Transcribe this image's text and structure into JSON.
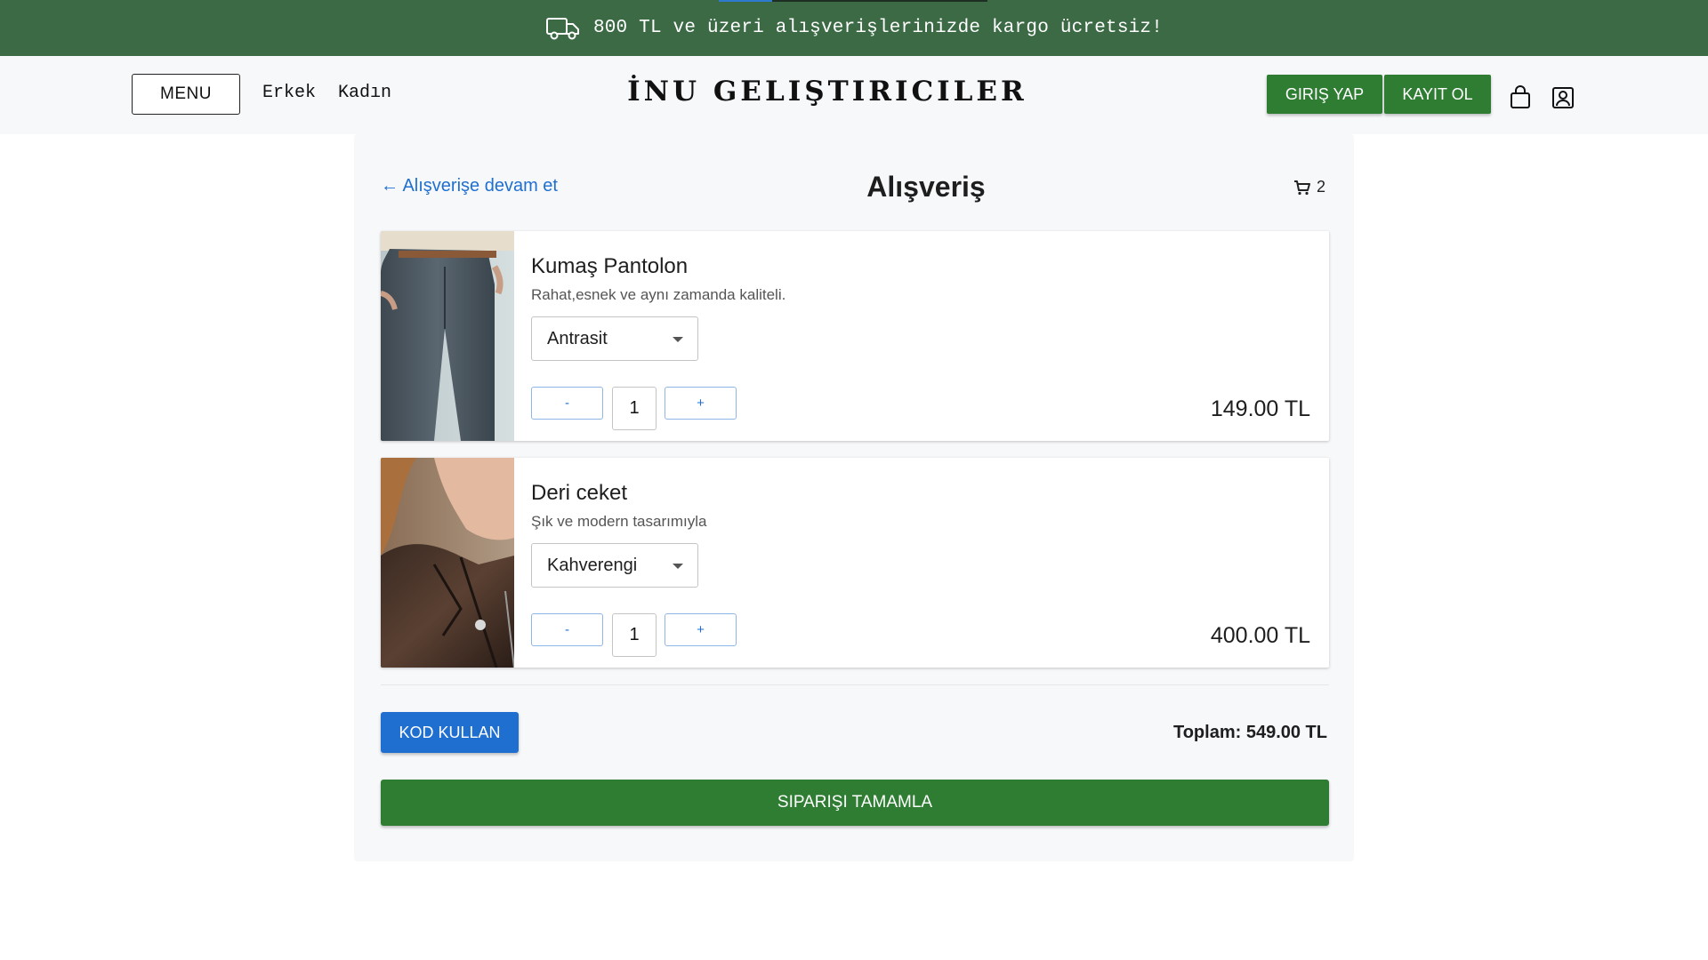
{
  "promo": {
    "icon": "truck-icon",
    "text": "800 TL ve üzeri alışverişlerinizde kargo ücretsiz!"
  },
  "header": {
    "menu_label": "MENU",
    "nav": [
      "Erkek",
      "Kadın"
    ],
    "brand": "İNU GELIŞTIRICILER",
    "login_label": "GIRIŞ YAP",
    "register_label": "KAYIT OL",
    "icons": [
      "shopping-bag-icon",
      "user-profile-icon"
    ]
  },
  "cart": {
    "back_link": "← Alışverişe devam et",
    "title": "Alışveriş",
    "count": "2",
    "items": [
      {
        "name": "Kumaş Pantolon",
        "description": "Rahat,esnek ve aynı zamanda kaliteli.",
        "color": "Antrasit",
        "quantity": "1",
        "minus": "-",
        "plus": "+",
        "price": "149.00 TL"
      },
      {
        "name": "Deri ceket",
        "description": "Şık ve modern tasarımıyla",
        "color": "Kahverengi",
        "quantity": "1",
        "minus": "-",
        "plus": "+",
        "price": "400.00 TL"
      }
    ],
    "coupon_label": "KOD KULLAN",
    "total_label": "Toplam: 549.00 TL",
    "checkout_label": "SIPARIŞI TAMAMLA"
  },
  "colors": {
    "promo_bg": "#3b6a45",
    "brand_green": "#2e7d32",
    "link_blue": "#1f6fd1"
  }
}
